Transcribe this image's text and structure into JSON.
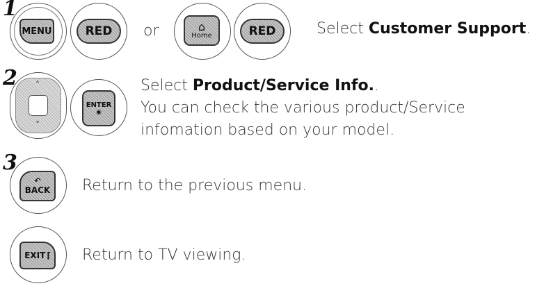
{
  "steps": [
    {
      "number": "1",
      "buttons": [
        "MENU",
        "RED",
        "RED"
      ],
      "home_label": "Home",
      "or_text": "or",
      "text_prefix": "Select ",
      "text_bold": "Customer Support",
      "text_suffix": "."
    },
    {
      "number": "2",
      "enter_label": "ENTER",
      "line1_prefix": "Select ",
      "line1_bold": "Product/Service Info.",
      "line1_suffix": ".",
      "line2": "You can check the various product/Service",
      "line3": "infomation based on your model."
    },
    {
      "number": "3",
      "back_label": "BACK",
      "text": "Return to the previous menu."
    },
    {
      "exit_label": "EXIT",
      "text": "Return to TV viewing."
    }
  ]
}
